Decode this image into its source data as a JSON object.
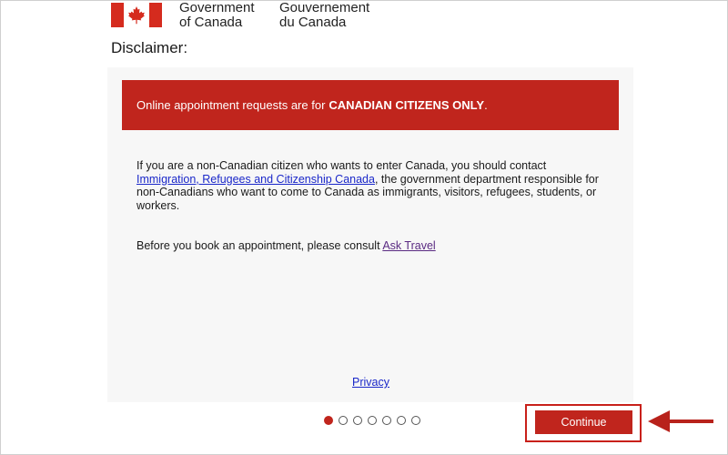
{
  "header": {
    "wordmark_en_line1": "Government",
    "wordmark_en_line2": "of Canada",
    "wordmark_fr_line1": "Gouvernement",
    "wordmark_fr_line2": "du Canada",
    "flag_icon": "canada-flag-icon"
  },
  "page": {
    "title": "Disclaimer:"
  },
  "alert": {
    "text": "Online appointment requests are for",
    "emphasis": "CANADIAN CITIZENS ONLY",
    "suffix": "."
  },
  "content": {
    "para1_before": "If you are a non-Canadian citizen who wants to enter Canada, you should contact ",
    "para1_link": "Immigration, Refugees and Citizenship Canada",
    "para1_after": ", the government department responsible for non-Canadians who want to come to Canada as immigrants, visitors, refugees, students, or workers.",
    "para2_before": "Before you book an appointment, please consult ",
    "para2_link": "Ask Travel"
  },
  "footer": {
    "privacy_label": "Privacy"
  },
  "pagination": {
    "total": 7,
    "current": 1
  },
  "actions": {
    "continue_label": "Continue"
  },
  "colors": {
    "brand_red": "#c0251d",
    "link_blue": "#1a27c9",
    "link_visited": "#5a2a82"
  }
}
